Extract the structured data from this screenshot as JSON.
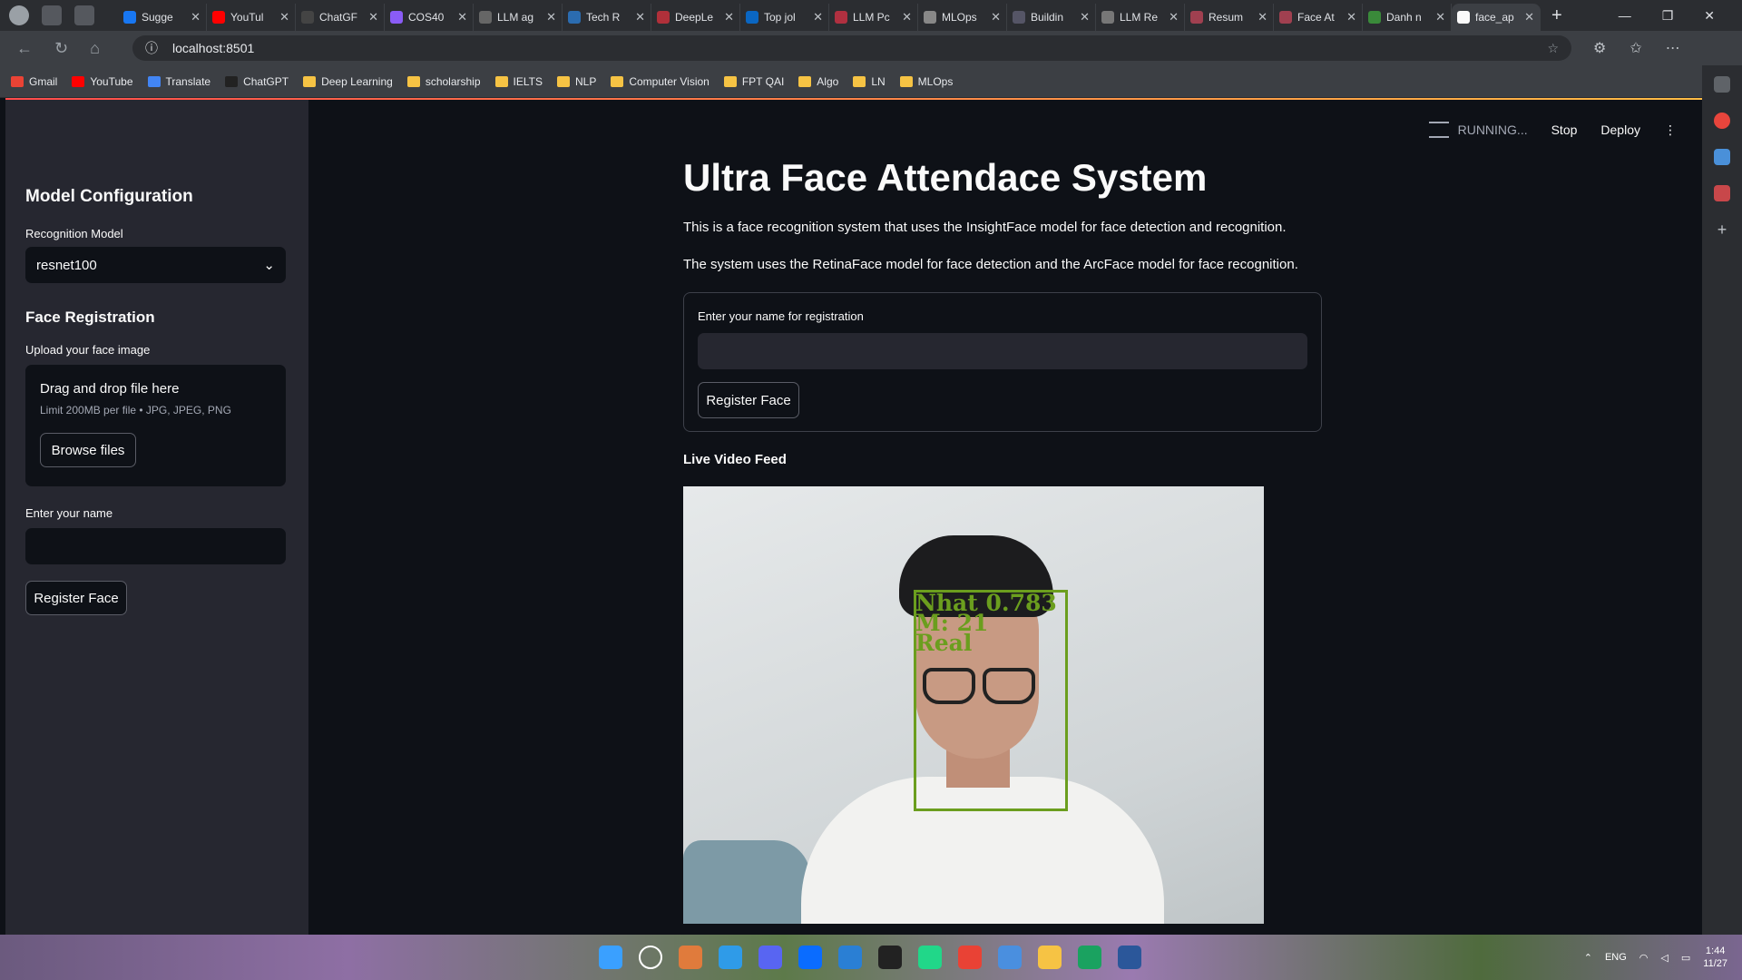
{
  "browser": {
    "tabs": [
      {
        "title": "Sugge",
        "color": "#1877f2"
      },
      {
        "title": "YouTul",
        "color": "#ff0000"
      },
      {
        "title": "ChatGF",
        "color": "#444"
      },
      {
        "title": "COS40",
        "color": "#8a5cf6"
      },
      {
        "title": "LLM ag",
        "color": "#666"
      },
      {
        "title": "Tech R",
        "color": "#2b6cb0"
      },
      {
        "title": "DeepLe",
        "color": "#b0303a"
      },
      {
        "title": "Top jol",
        "color": "#0a66c2"
      },
      {
        "title": "LLM Pc",
        "color": "#b03040"
      },
      {
        "title": "MLOps",
        "color": "#888"
      },
      {
        "title": "Buildin",
        "color": "#556"
      },
      {
        "title": "LLM Re",
        "color": "#777"
      },
      {
        "title": "Resum",
        "color": "#a04050"
      },
      {
        "title": "Face At",
        "color": "#a04050"
      },
      {
        "title": "Danh n",
        "color": "#3a8a3a"
      },
      {
        "title": "face_ap",
        "color": "#fafafa"
      }
    ],
    "new_tab": "+",
    "url": "localhost:8501",
    "bookmarks": [
      {
        "label": "Gmail",
        "color": "#ea4335"
      },
      {
        "label": "YouTube",
        "color": "#ff0000"
      },
      {
        "label": "Translate",
        "color": "#4285f4"
      },
      {
        "label": "ChatGPT",
        "color": "#222"
      },
      {
        "label": "Deep Learning",
        "color": "#f6c344"
      },
      {
        "label": "scholarship",
        "color": "#f6c344"
      },
      {
        "label": "IELTS",
        "color": "#f6c344"
      },
      {
        "label": "NLP",
        "color": "#f6c344"
      },
      {
        "label": "Computer Vision",
        "color": "#f6c344"
      },
      {
        "label": "FPT QAI",
        "color": "#f6c344"
      },
      {
        "label": "Algo",
        "color": "#f6c344"
      },
      {
        "label": "LN",
        "color": "#f6c344"
      },
      {
        "label": "MLOps",
        "color": "#f6c344"
      }
    ]
  },
  "app": {
    "status": {
      "running": "RUNNING...",
      "stop": "Stop",
      "deploy": "Deploy"
    },
    "sidebar": {
      "model_title": "Model Configuration",
      "model_label": "Recognition Model",
      "model_value": "resnet100",
      "registration_title": "Face Registration",
      "upload_label": "Upload your face image",
      "drop_text": "Drag and drop file here",
      "drop_limit": "Limit 200MB per file • JPG, JPEG, PNG",
      "browse": "Browse files",
      "name_label": "Enter your name",
      "register": "Register Face"
    },
    "main": {
      "title": "Ultra Face Attendace System",
      "para1": "This is a face recognition system that uses the InsightFace model for face detection and recognition.",
      "para2": "The system uses the RetinaFace model for face detection and the ArcFace model for face recognition.",
      "form_label": "Enter your name for registration",
      "form_button": "Register Face",
      "feed_title": "Live Video Feed",
      "detection": {
        "line1": "Nhat 0.783",
        "line2": "M: 21",
        "line3": "Real"
      }
    }
  },
  "taskbar": {
    "lang": "ENG",
    "time": "1:44",
    "date": "11/27"
  }
}
